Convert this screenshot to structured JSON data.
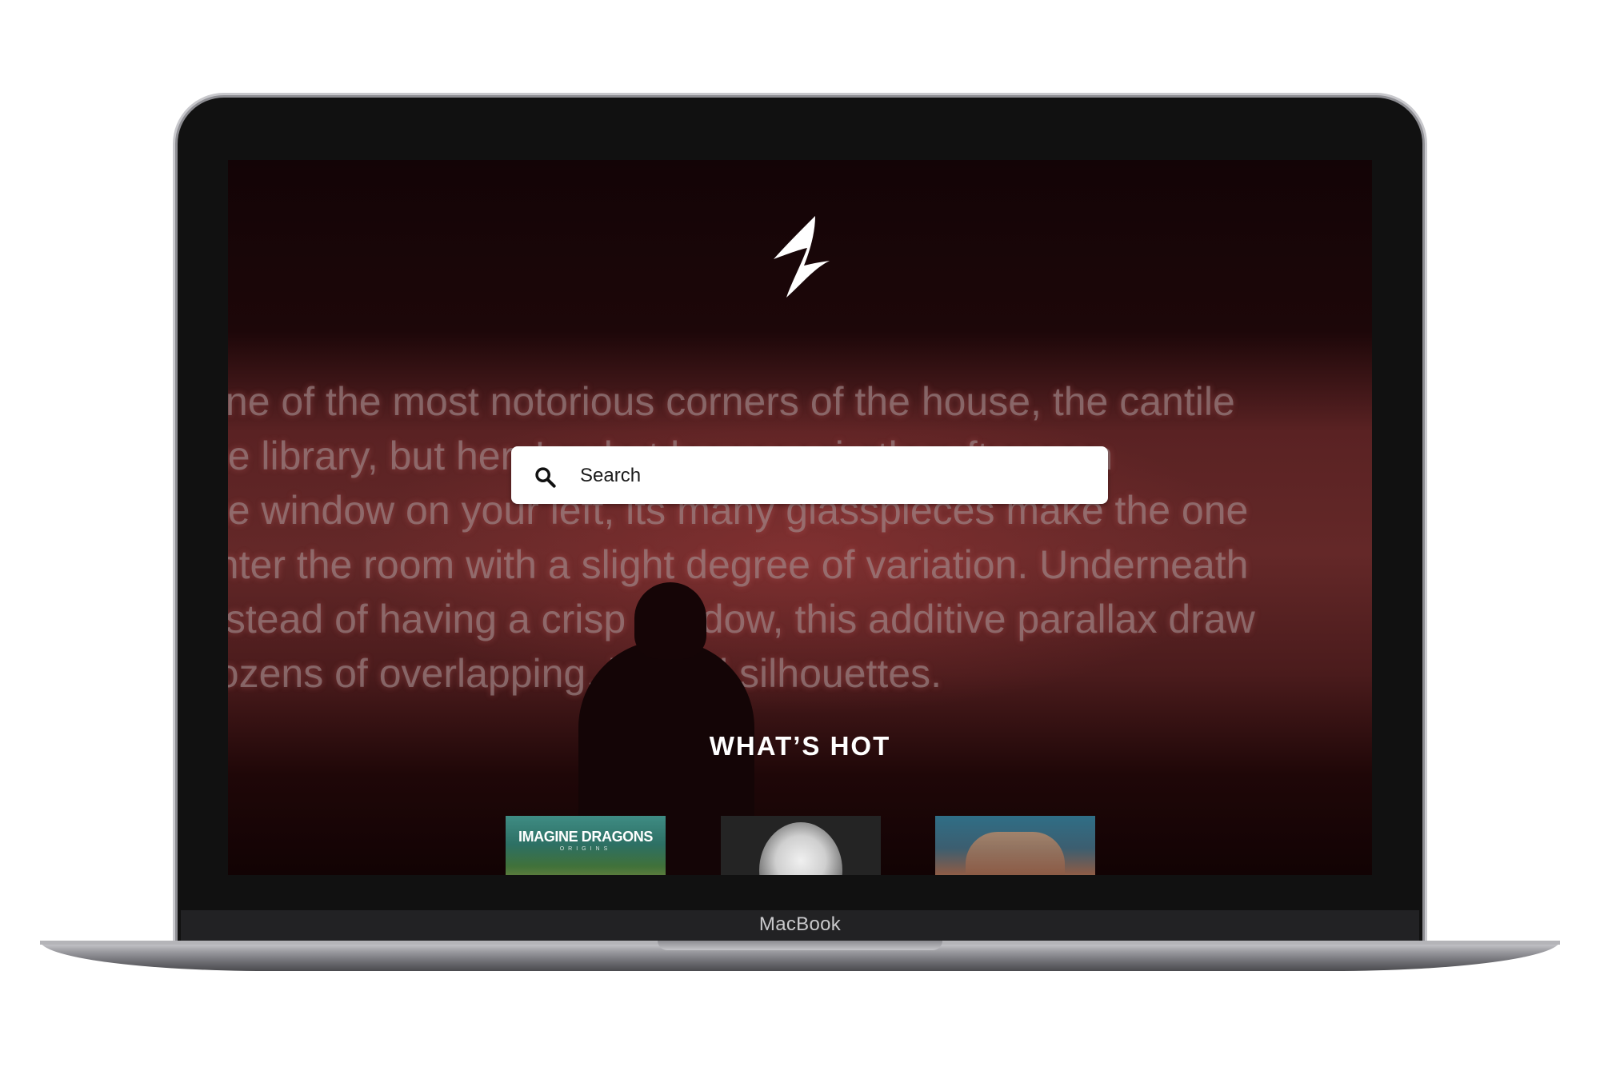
{
  "device": {
    "brand_label": "MacBook"
  },
  "app": {
    "logo_icon": "stylized-lightning-logo",
    "background_text_lines": [
      "One of the most notorious corners of the house, the cantile",
      "the library, but here's what happens in the afternoon",
      "the window on your left, its many glasspieces make the one",
      "enter the room with a slight degree of variation. Underneath",
      "instead of having a crisp shadow, this additive parallax draw",
      "dozens of overlapping, jagged silhouettes."
    ],
    "search": {
      "placeholder": "Search",
      "value": "",
      "icon": "search-icon"
    },
    "whats_hot": {
      "title": "WHAT’S HOT",
      "albums": [
        {
          "title": "IMAGINE DRAGONS",
          "subtitle": "ORIGINS"
        },
        {
          "title": "",
          "subtitle": ""
        },
        {
          "title": "",
          "subtitle": ""
        }
      ]
    }
  },
  "colors": {
    "accent_text": "#ffffff",
    "background_red": "#642828"
  }
}
